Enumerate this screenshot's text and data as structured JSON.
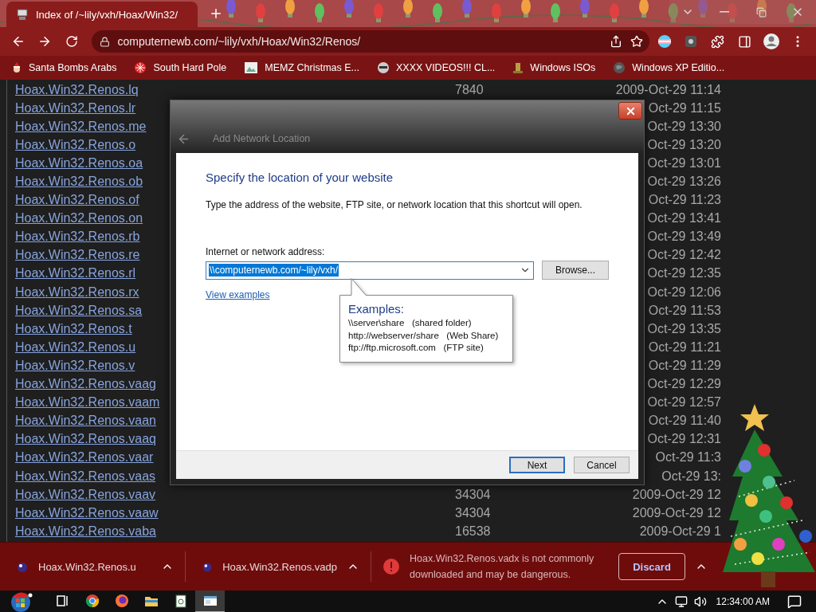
{
  "browser": {
    "tab": {
      "title": "Index of /~lily/vxh/Hoax/Win32/",
      "selected": true
    },
    "address": "computernewb.com/~lily/vxh/Hoax/Win32/Renos/",
    "bookmarks": [
      "Santa Bombs Arabs",
      "South Hard Pole",
      "MEMZ Christmas E...",
      "XXXX VIDEOS!!! CL...",
      "Windows ISOs",
      "Windows XP Editio..."
    ]
  },
  "listing": {
    "rows": [
      {
        "name": "Hoax.Win32.Renos.lq",
        "size": "7840",
        "date": "2009-Oct-29 11:14"
      },
      {
        "name": "Hoax.Win32.Renos.lr",
        "date": "Oct-29 11:15"
      },
      {
        "name": "Hoax.Win32.Renos.me",
        "date": "Oct-29 13:30"
      },
      {
        "name": "Hoax.Win32.Renos.o",
        "date": "Oct-29 13:20"
      },
      {
        "name": "Hoax.Win32.Renos.oa",
        "date": "Oct-29 13:01"
      },
      {
        "name": "Hoax.Win32.Renos.ob",
        "date": "Oct-29 13:26"
      },
      {
        "name": "Hoax.Win32.Renos.of",
        "date": "Oct-29 11:23"
      },
      {
        "name": "Hoax.Win32.Renos.on",
        "date": "Oct-29 13:41"
      },
      {
        "name": "Hoax.Win32.Renos.rb",
        "date": "Oct-29 13:49"
      },
      {
        "name": "Hoax.Win32.Renos.re",
        "date": "Oct-29 12:42"
      },
      {
        "name": "Hoax.Win32.Renos.rl",
        "date": "Oct-29 12:35"
      },
      {
        "name": "Hoax.Win32.Renos.rx",
        "date": "Oct-29 12:06"
      },
      {
        "name": "Hoax.Win32.Renos.sa",
        "date": "Oct-29 11:53"
      },
      {
        "name": "Hoax.Win32.Renos.t",
        "date": "Oct-29 13:35"
      },
      {
        "name": "Hoax.Win32.Renos.u",
        "date": "Oct-29 11:21"
      },
      {
        "name": "Hoax.Win32.Renos.v",
        "date": "Oct-29 11:29"
      },
      {
        "name": "Hoax.Win32.Renos.vaag",
        "date": "Oct-29 12:29"
      },
      {
        "name": "Hoax.Win32.Renos.vaam",
        "date": "Oct-29 12:57"
      },
      {
        "name": "Hoax.Win32.Renos.vaan",
        "date": "Oct-29 11:40"
      },
      {
        "name": "Hoax.Win32.Renos.vaaq",
        "date": "Oct-29 12:31"
      },
      {
        "name": "Hoax.Win32.Renos.vaar",
        "date": "Oct-29 11:3"
      },
      {
        "name": "Hoax.Win32.Renos.vaas",
        "date": "Oct-29 13:"
      },
      {
        "name": "Hoax.Win32.Renos.vaav",
        "size": "34304",
        "date": "2009-Oct-29 12"
      },
      {
        "name": "Hoax.Win32.Renos.vaaw",
        "size": "34304",
        "date": "2009-Oct-29 12"
      },
      {
        "name": "Hoax.Win32.Renos.vaba",
        "size": "16538",
        "date": "2009-Oct-29 1"
      }
    ]
  },
  "dialog": {
    "title": "Add Network Location",
    "heading": "Specify the location of your website",
    "description": "Type the address of the website, FTP site, or network location that this shortcut will open.",
    "field_label": "Internet or network address:",
    "field_value": "\\\\computernewb.com/~lily/vxh/",
    "value_selected": true,
    "browse_button": "Browse...",
    "examples_link": "View examples",
    "tooltip": {
      "heading": "Examples:",
      "lines": [
        "\\\\server\\share   (shared folder)",
        "http://webserver/share   (Web Share)",
        "ftp://ftp.microsoft.com   (FTP site)"
      ]
    },
    "buttons": [
      {
        "label": "Next",
        "focused": true
      },
      {
        "label": "Cancel",
        "focused": false
      }
    ]
  },
  "downloads": {
    "items": [
      "Hoax.Win32.Renos.u",
      "Hoax.Win32.Renos.vadp"
    ],
    "warning": {
      "text": "Hoax.Win32.Renos.vadx is not commonly downloaded and may be dangerous.",
      "button": "Discard"
    }
  },
  "taskbar": {
    "apps": [
      {
        "kind": "taskview",
        "selected": false
      },
      {
        "kind": "chrome",
        "selected": false
      },
      {
        "kind": "firefox",
        "selected": false
      },
      {
        "kind": "explorer",
        "selected": false
      },
      {
        "kind": "notepad",
        "selected": false
      },
      {
        "kind": "window",
        "selected": true
      }
    ],
    "clock": "12:34:00 AM"
  }
}
